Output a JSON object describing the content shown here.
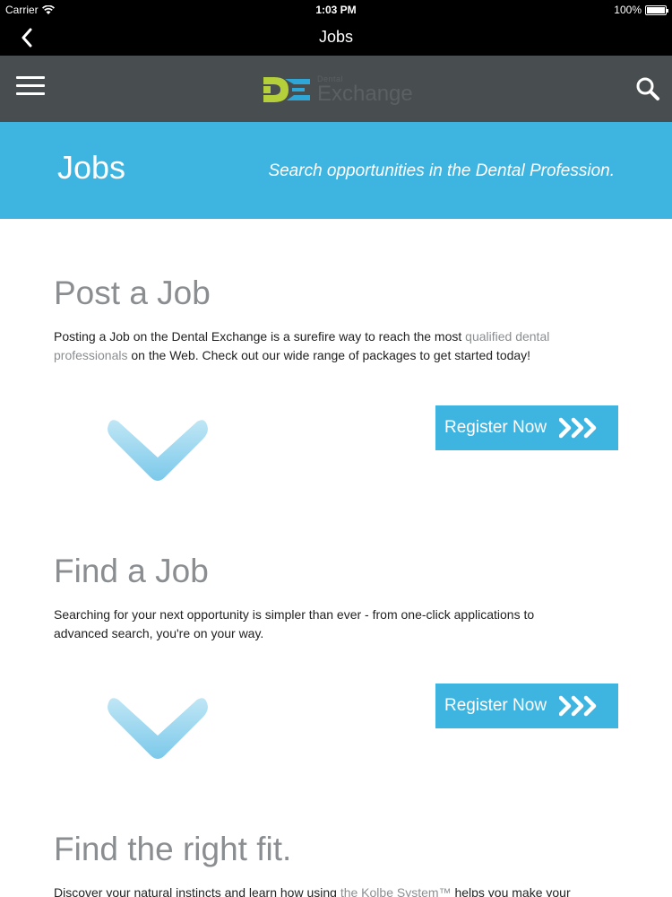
{
  "status_bar": {
    "carrier": "Carrier",
    "time": "1:03 PM",
    "battery": "100%"
  },
  "nav_bar": {
    "title": "Jobs"
  },
  "header": {
    "logo_small": "Dental",
    "logo_big": "Exchange",
    "icons": [
      "menu-icon",
      "search-icon"
    ]
  },
  "hero": {
    "title": "Jobs",
    "tagline": "Search opportunities in the Dental Profession."
  },
  "sections": [
    {
      "title": "Post a Job",
      "text_before": "Posting a Job on the Dental Exchange is a surefire way to reach the most ",
      "text_link": "qualified dental professionals",
      "text_after": " on the Web. Check out our wide range of packages to get started today!",
      "button_label": "Register Now"
    },
    {
      "title": "Find a Job",
      "text_before": "Searching for your next opportunity is simpler than ever - from one-click applications to advanced search, you're on your way.",
      "text_link": "",
      "text_after": "",
      "button_label": "Register Now"
    },
    {
      "title": "Find the right fit.",
      "text_before": "Discover your natural instincts and learn how using ",
      "text_link": "the Kolbe System™",
      "text_after": " helps you make your",
      "button_label": ""
    }
  ],
  "colors": {
    "accent": "#3db5e0",
    "header_bg": "#484d4f",
    "heading_gray": "#8b8e91",
    "logo_green": "#b5cf3b",
    "logo_blue": "#2ea7d8"
  }
}
